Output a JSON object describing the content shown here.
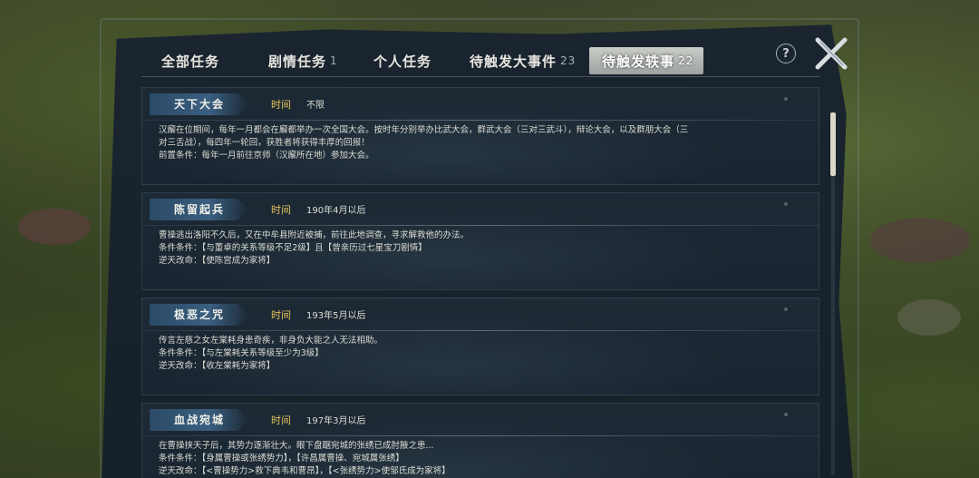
{
  "tabs": [
    {
      "label": "全部任务",
      "badge": ""
    },
    {
      "label": "剧情任务",
      "badge": "1"
    },
    {
      "label": "个人任务",
      "badge": ""
    },
    {
      "label": "待触发大事件",
      "badge": "23"
    },
    {
      "label": "待触发轶事",
      "badge": "22",
      "active": true
    }
  ],
  "help_glyph": "?",
  "time_label": "时间",
  "events": [
    {
      "title": "天下大会",
      "time": "不限",
      "lines": [
        "汉廨在位期间，每年一月都会在廨都举办一次全国大会。按时年分别举办比武大会，群武大会（三对三武斗），辩论大会，以及群朋大会（三",
        "对三舌战），每四年一轮回，获胜者将获得丰厚的回报！",
        "前置条件：每年一月前往京师（汉廨所在地）参加大会。"
      ]
    },
    {
      "title": "陈留起兵",
      "time": "190年4月以后",
      "lines": [
        "曹操逃出洛阳不久后，又在中牟县附近被捕，前往此地调查，寻求解救他的办法。",
        "条件条件：【与董卓的关系等级不足2级】且【曾亲历过七星宝刀剧情】",
        "逆天改命：【使陈宫成为家将】"
      ]
    },
    {
      "title": "极恶之咒",
      "time": "193年5月以后",
      "lines": [
        "传言左慈之女左棠耗身患奇疾，非身负大能之人无法相助。",
        "条件条件：【与左棠耗关系等级至少为3级】",
        "逆天改命：【收左棠耗为家将】"
      ]
    },
    {
      "title": "血战宛城",
      "time": "197年3月以后",
      "lines": [
        "在曹操挟天子后，其势力逐渐壮大。眼下盘踞宛城的张绣已成肘腋之患...",
        "条件条件：【身属曹操或张绣势力】，【许昌属曹操、宛城属张绣】",
        "逆天改命：【<曹操势力>救下典韦和曹昂】，【<张绣势力>使邹氏成为家将】"
      ]
    }
  ]
}
